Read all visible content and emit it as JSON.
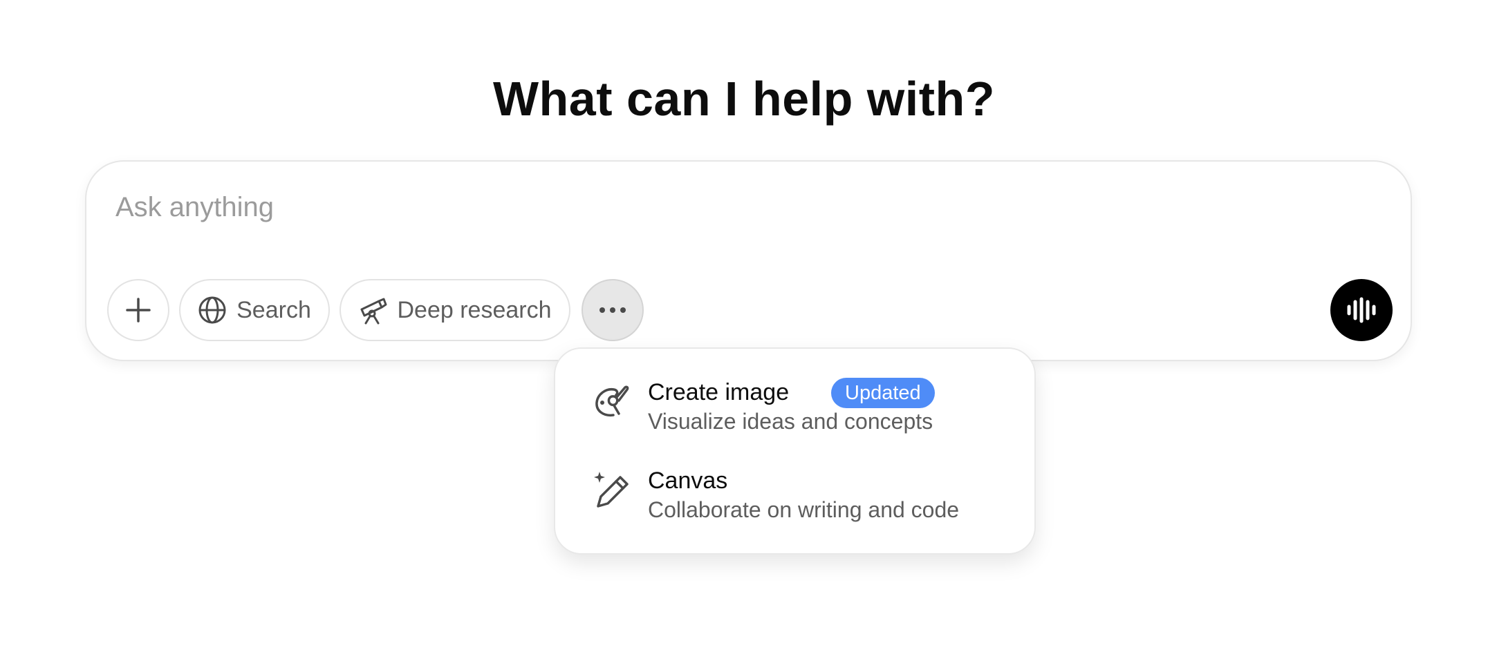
{
  "heading": "What can I help with?",
  "composer": {
    "placeholder": "Ask anything",
    "value": ""
  },
  "toolbar": {
    "plus_icon": "plus-icon",
    "search_label": "Search",
    "search_icon": "globe-icon",
    "deep_research_label": "Deep research",
    "deep_research_icon": "telescope-icon",
    "more_icon": "ellipsis-icon",
    "voice_icon": "voice-waveform-icon"
  },
  "menu": {
    "items": [
      {
        "title": "Create image",
        "badge": "Updated",
        "description": "Visualize ideas and concepts",
        "icon": "palette-brush-icon"
      },
      {
        "title": "Canvas",
        "description": "Collaborate on writing and code",
        "icon": "sparkle-pencil-icon"
      }
    ]
  },
  "colors": {
    "badge_bg": "#4f8cf7",
    "voice_button_bg": "#000000",
    "more_button_active_bg": "#e7e7e7"
  }
}
